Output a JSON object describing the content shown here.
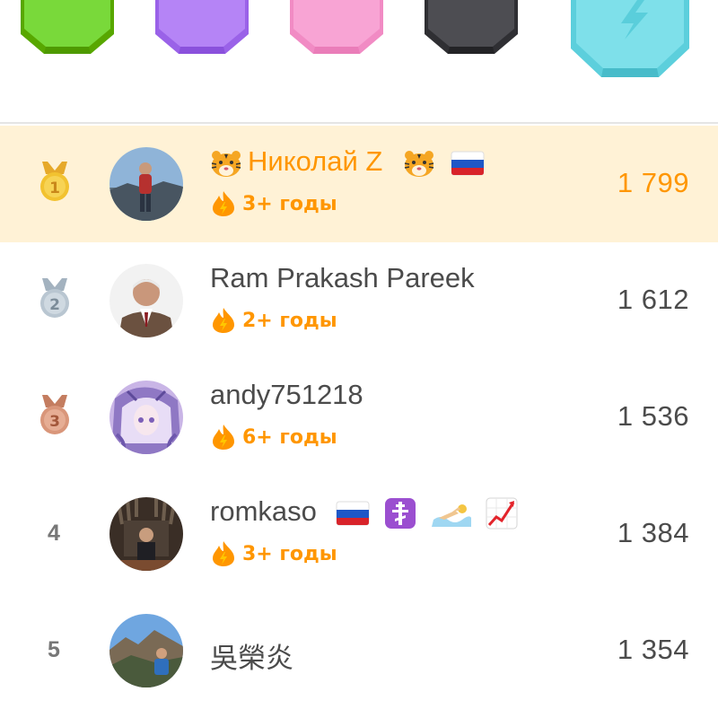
{
  "leagues": [
    {
      "icon": "emerald-league-badge",
      "color": "#79d93a"
    },
    {
      "icon": "amethyst-league-badge",
      "color": "#b584f6"
    },
    {
      "icon": "pearl-league-badge",
      "color": "#f8a4d4"
    },
    {
      "icon": "obsidian-league-badge",
      "color": "#4d4d52"
    },
    {
      "icon": "diamond-league-badge",
      "color": "#7ee0ea"
    }
  ],
  "colors": {
    "accent": "#ff9600",
    "highlight_row": "#fff2d6",
    "gold": "#f2c230",
    "silver": "#b9c6d1",
    "bronze": "#d9967a"
  },
  "leaderboard": [
    {
      "rank": "1",
      "name": "Николай Z",
      "streak": "3+ годы",
      "xp": "1 799",
      "emojis": [
        "tiger-face-emoji",
        "tiger-face-emoji",
        "russia-flag-emoji"
      ],
      "highlighted": true
    },
    {
      "rank": "2",
      "name": "Ram Prakash Pareek",
      "streak": "2+ годы",
      "xp": "1 612",
      "emojis": []
    },
    {
      "rank": "3",
      "name": "andy751218",
      "streak": "6+ годы",
      "xp": "1 536",
      "emojis": []
    },
    {
      "rank": "4",
      "name": "romkaso",
      "streak": "3+ годы",
      "xp": "1 384",
      "emojis": [
        "russia-flag-emoji",
        "orthodox-cross-emoji",
        "swimmer-emoji",
        "chart-increasing-emoji"
      ]
    },
    {
      "rank": "5",
      "name": "吳榮炎",
      "streak": "",
      "xp": "1 354",
      "emojis": []
    }
  ]
}
